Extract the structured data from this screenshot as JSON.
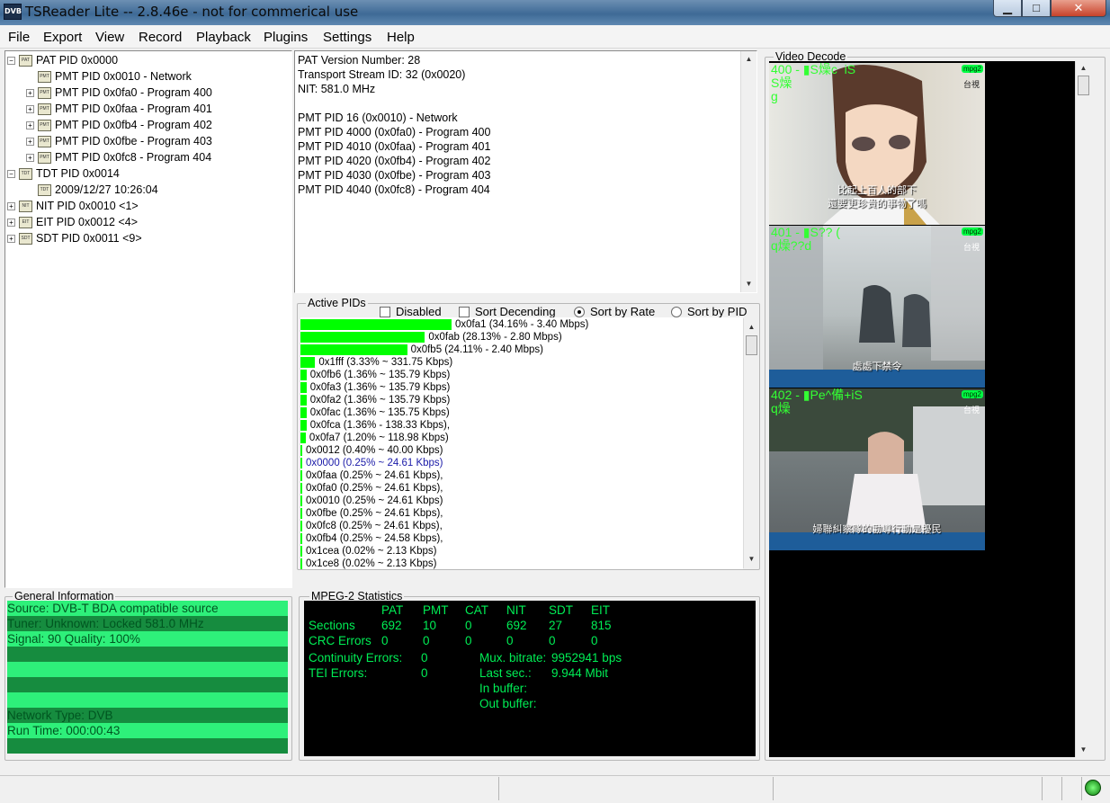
{
  "window": {
    "title": "TSReader Lite -- 2.8.46e - not for commerical use",
    "icon_text": "DVB"
  },
  "menu": [
    "File",
    "Export",
    "View",
    "Record",
    "Playback",
    "Plugins",
    "Settings",
    "Help"
  ],
  "tree": [
    {
      "label": "PAT PID 0x0000",
      "icon": "PAT",
      "toggle": "−"
    },
    {
      "label": "PMT PID 0x0010 - Network",
      "icon": "PMT",
      "toggle": ""
    },
    {
      "label": "PMT PID 0x0fa0 - Program 400",
      "icon": "PMT",
      "toggle": "+"
    },
    {
      "label": "PMT PID 0x0faa - Program 401",
      "icon": "PMT",
      "toggle": "+"
    },
    {
      "label": "PMT PID 0x0fb4 - Program 402",
      "icon": "PMT",
      "toggle": "+"
    },
    {
      "label": "PMT PID 0x0fbe - Program 403",
      "icon": "PMT",
      "toggle": "+"
    },
    {
      "label": "PMT PID 0x0fc8 - Program 404",
      "icon": "PMT",
      "toggle": "+"
    },
    {
      "label": "TDT PID 0x0014",
      "icon": "TDT",
      "toggle": "−"
    },
    {
      "label": "2009/12/27 10:26:04",
      "icon": "TDT",
      "toggle": ""
    },
    {
      "label": "NIT PID 0x0010 <1>",
      "icon": "NIT",
      "toggle": "+"
    },
    {
      "label": "EIT PID 0x0012 <4>",
      "icon": "EIT",
      "toggle": "+"
    },
    {
      "label": "SDT PID 0x0011 <9>",
      "icon": "SDT",
      "toggle": "+"
    }
  ],
  "info_lines": [
    "PAT Version Number: 28",
    "Transport Stream ID: 32 (0x0020)",
    "NIT: 581.0 MHz",
    "",
    "PMT PID 16 (0x0010) - Network",
    "PMT PID 4000 (0x0fa0) - Program 400",
    "PMT PID 4010 (0x0faa) - Program 401",
    "PMT PID 4020 (0x0fb4) - Program 402",
    "PMT PID 4030 (0x0fbe) - Program 403",
    "PMT PID 4040 (0x0fc8) - Program 404"
  ],
  "active_pids": {
    "group_label": "Active PIDs",
    "options": {
      "disabled": "Disabled",
      "sort_desc": "Sort Decending",
      "sort_rate": "Sort by Rate",
      "sort_pid": "Sort by PID"
    },
    "rows": [
      {
        "text": "0x0fa1 (34.16% - 3.40 Mbps)",
        "pct": 34.16
      },
      {
        "text": "0x0fab (28.13% - 2.80 Mbps)",
        "pct": 28.13
      },
      {
        "text": "0x0fb5 (24.11% - 2.40 Mbps)",
        "pct": 24.11
      },
      {
        "text": "0x1fff (3.33% ~ 331.75 Kbps)",
        "pct": 3.33
      },
      {
        "text": "0x0fb6 (1.36% ~ 135.79 Kbps)",
        "pct": 1.36
      },
      {
        "text": "0x0fa3 (1.36% ~ 135.79 Kbps)",
        "pct": 1.36
      },
      {
        "text": "0x0fa2 (1.36% ~ 135.79 Kbps)",
        "pct": 1.36
      },
      {
        "text": "0x0fac (1.36% ~ 135.75 Kbps)",
        "pct": 1.36
      },
      {
        "text": "0x0fca (1.36% - 138.33 Kbps),",
        "pct": 1.36
      },
      {
        "text": "0x0fa7 (1.20% ~ 118.98 Kbps)",
        "pct": 1.2
      },
      {
        "text": "0x0012 (0.40% ~ 40.00 Kbps)",
        "pct": 0.4
      },
      {
        "text": "0x0000 (0.25% ~ 24.61 Kbps)",
        "pct": 0.25,
        "highlight": true
      },
      {
        "text": "0x0faa (0.25% ~ 24.61 Kbps),",
        "pct": 0.25
      },
      {
        "text": "0x0fa0 (0.25% ~ 24.61 Kbps),",
        "pct": 0.25
      },
      {
        "text": "0x0010 (0.25% ~ 24.61 Kbps)",
        "pct": 0.25
      },
      {
        "text": "0x0fbe (0.25% ~ 24.61 Kbps),",
        "pct": 0.25
      },
      {
        "text": "0x0fc8 (0.25% ~ 24.61 Kbps),",
        "pct": 0.25
      },
      {
        "text": "0x0fb4 (0.25% ~ 24.58 Kbps),",
        "pct": 0.25
      },
      {
        "text": "0x1cea (0.02% ~ 2.13 Kbps)",
        "pct": 0.02
      },
      {
        "text": "0x1ce8 (0.02% ~ 2.13 Kbps)",
        "pct": 0.02
      }
    ]
  },
  "general": {
    "group_label": "General Information",
    "rows": [
      "Source: DVB-T BDA compatible source",
      "Tuner: Unknown: Locked 581.0 MHz",
      "Signal: 90 Quality: 100%",
      "",
      "",
      "",
      "",
      "Network Type: DVB",
      "Run Time: 000:00:43",
      ""
    ],
    "row_colors": [
      "#2ef07a",
      "#168c3f"
    ]
  },
  "mpeg": {
    "group_label": "MPEG-2 Statistics",
    "headers": [
      "PAT",
      "PMT",
      "CAT",
      "NIT",
      "SDT",
      "EIT"
    ],
    "sections_label": "Sections",
    "sections": [
      "692",
      "10",
      "0",
      "692",
      "27",
      "815"
    ],
    "crc_label": "CRC Errors",
    "crc": [
      "0",
      "0",
      "0",
      "0",
      "0",
      "0"
    ],
    "continuity_label": "Continuity Errors:",
    "continuity": "0",
    "tei_label": "TEI Errors:",
    "tei": "0",
    "mux_label": "Mux. bitrate:",
    "mux": "9952941 bps",
    "last_label": "Last sec.:",
    "last": "9.944 Mbit",
    "in_buffer_label": "In buffer:",
    "out_buffer_label": "Out buffer:"
  },
  "video": {
    "group_label": "Video Decode",
    "thumbs": [
      {
        "label": "400 - ▮S燥c  iS\nS燥\ng",
        "badge": "mpg2",
        "subtitle_1": "比起上百人的部下",
        "subtitle_2": "還要更珍貴的事物了嗎",
        "logo": "台視"
      },
      {
        "label": "401 - ▮S?? (\nq燥??d",
        "badge": "mpg2",
        "subtitle_1": "處處下禁令",
        "logo": "台視"
      },
      {
        "label": "402 - ▮Pe^備+iS\nq燥",
        "badge": "mpg2",
        "subtitle_1": "婦聯糾察隊的勸導行動是擾民",
        "logo": "台視"
      }
    ]
  }
}
